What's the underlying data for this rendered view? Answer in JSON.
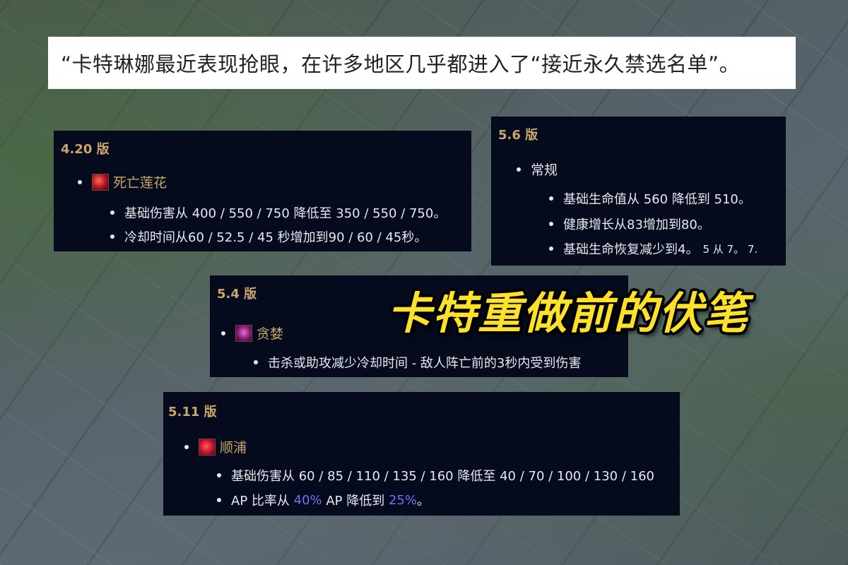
{
  "quote": "“卡特琳娜最近表现抢眼，在许多地区几乎都进入了“接近永久禁选名单”。",
  "headline": "卡特重做前的伏笔",
  "panels": {
    "p420": {
      "version": "4.20 版",
      "item": {
        "icon": "death-lotus-icon",
        "name": "死亡莲花"
      },
      "details": [
        "基础伤害从 400 / 550 / 750 降低至 350 / 550 / 750。",
        "冷却时间从60 / 52.5 / 45 秒增加到90 / 60 / 45秒。"
      ]
    },
    "p56": {
      "version": "5.6 版",
      "item": {
        "name": "常规"
      },
      "details": [
        "基础生命值从 560 降低到 510。",
        "健康增长从83增加到80。",
        "基础生命恢复减少到4。"
      ],
      "detail_suffix": "5 从 7。 7."
    },
    "p54": {
      "version": "5.4 版",
      "item": {
        "icon": "voracity-icon",
        "name": "贪婪"
      },
      "details": [
        "击杀或助攻减少冷却时间 - 敌人阵亡前的3秒内受到伤害"
      ]
    },
    "p511": {
      "version": "5.11 版",
      "item": {
        "icon": "shunpo-icon",
        "name": "顺浦"
      },
      "details": [
        "基础伤害从 60 / 85 / 110 / 135 / 160 降低至 40 / 70 / 100 / 130 / 160"
      ],
      "ap_line": {
        "prefix": "AP 比率从 ",
        "from": "40%",
        "mid": " AP 降低到 ",
        "to": "25%",
        "end": "。"
      }
    }
  },
  "colors": {
    "version": "#c9a66b",
    "highlight": "#7a6ff0",
    "panel_bg": "#050b1c",
    "headline": "#ffe12a"
  }
}
